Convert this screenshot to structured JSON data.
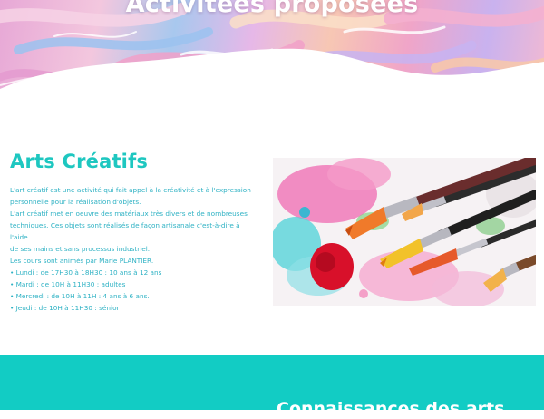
{
  "hero": {
    "title": "Activitées proposées"
  },
  "section": {
    "title": "Arts Créatifs",
    "lines": [
      "L'art créatif est une activité qui fait appel à la créativité et à l'expression",
      "personnelle pour la réalisation d'objets.",
      "L'art créatif met en oeuvre des matériaux très divers et de nombreuses",
      "techniques. Ces objets sont réalisés de façon artisanale c'est-à-dire à l'aide",
      "de ses mains et sans processus industriel.",
      "Les cours sont animés par Marie PLANTIER.",
      "• Lundi : de 17H30 à 18H30 : 10 ans à 12 ans",
      "• Mardi : de 10H à 11H30 : adultes",
      "• Mercredi : de 10H à 11H : 4 ans à 6 ans.",
      "• Jeudi : de 10H à 11H30 : sénior"
    ]
  },
  "next_section": {
    "title": "Connaissances des arts"
  },
  "colors": {
    "accent": "#1ec7c0",
    "band": "#12ccc4",
    "text": "#2fb2c4"
  }
}
